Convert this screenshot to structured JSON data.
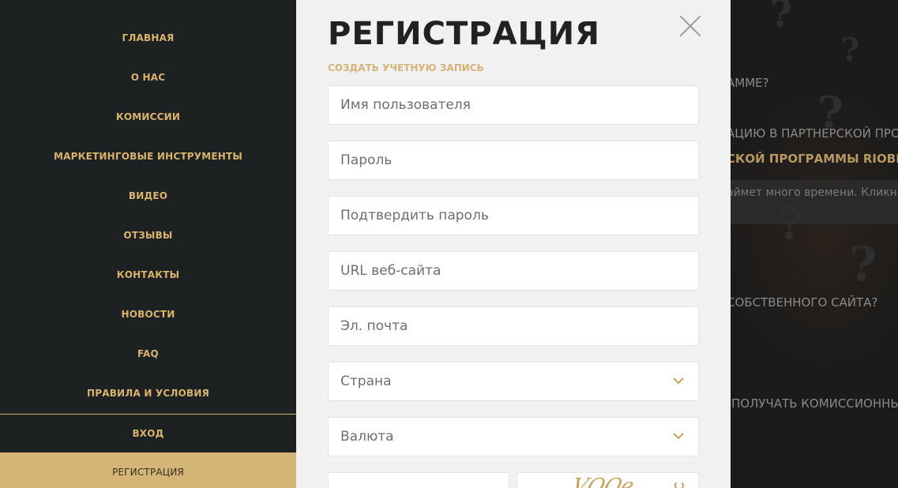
{
  "sidebar": {
    "items": [
      {
        "label": "ГЛАВНАЯ"
      },
      {
        "label": "О НАС"
      },
      {
        "label": "КОМИССИИ"
      },
      {
        "label": "МАРКЕТИНГОВЫЕ ИНСТРУМЕНТЫ"
      },
      {
        "label": "ВИДЕО"
      },
      {
        "label": "ОТЗЫВЫ"
      },
      {
        "label": "КОНТАКТЫ"
      },
      {
        "label": "НОВОСТИ"
      },
      {
        "label": "FAQ"
      },
      {
        "label": "ПРАВИЛА И УСЛОВИЯ"
      },
      {
        "label": "ВХОД"
      },
      {
        "label": "РЕГИСТРАЦИЯ"
      }
    ]
  },
  "modal": {
    "title": "РЕГИСТРАЦИЯ",
    "subtitle": "СОЗДАТЬ УЧЕТНУЮ ЗАПИСЬ",
    "fields": {
      "username": {
        "placeholder": "Имя пользователя",
        "value": ""
      },
      "password": {
        "placeholder": "Пароль",
        "value": ""
      },
      "confirm_password": {
        "placeholder": "Подтвердить пароль",
        "value": ""
      },
      "website": {
        "placeholder": "URL веб-сайта",
        "value": ""
      },
      "email": {
        "placeholder": "Эл. почта",
        "value": ""
      }
    },
    "selects": {
      "country": {
        "label": "Страна"
      },
      "currency": {
        "label": "Валюта"
      }
    },
    "captcha_text": "VQQe"
  },
  "background": {
    "lines": [
      "АММЕ?",
      "АЦИЮ В ПАРТНЕРСКОЙ ПРОГ",
      "СКОЙ ПРОГРАММЫ RIOBET?",
      "аймет много времени. Кликнит",
      "СОБСТВЕННОГО САЙТА?",
      "ПОЛУЧАТЬ КОМИССИОННЫ"
    ]
  },
  "colors": {
    "sidebar_bg": "#1e2122",
    "accent_gold": "#d4b477",
    "modal_bg": "#f1f1f1"
  }
}
